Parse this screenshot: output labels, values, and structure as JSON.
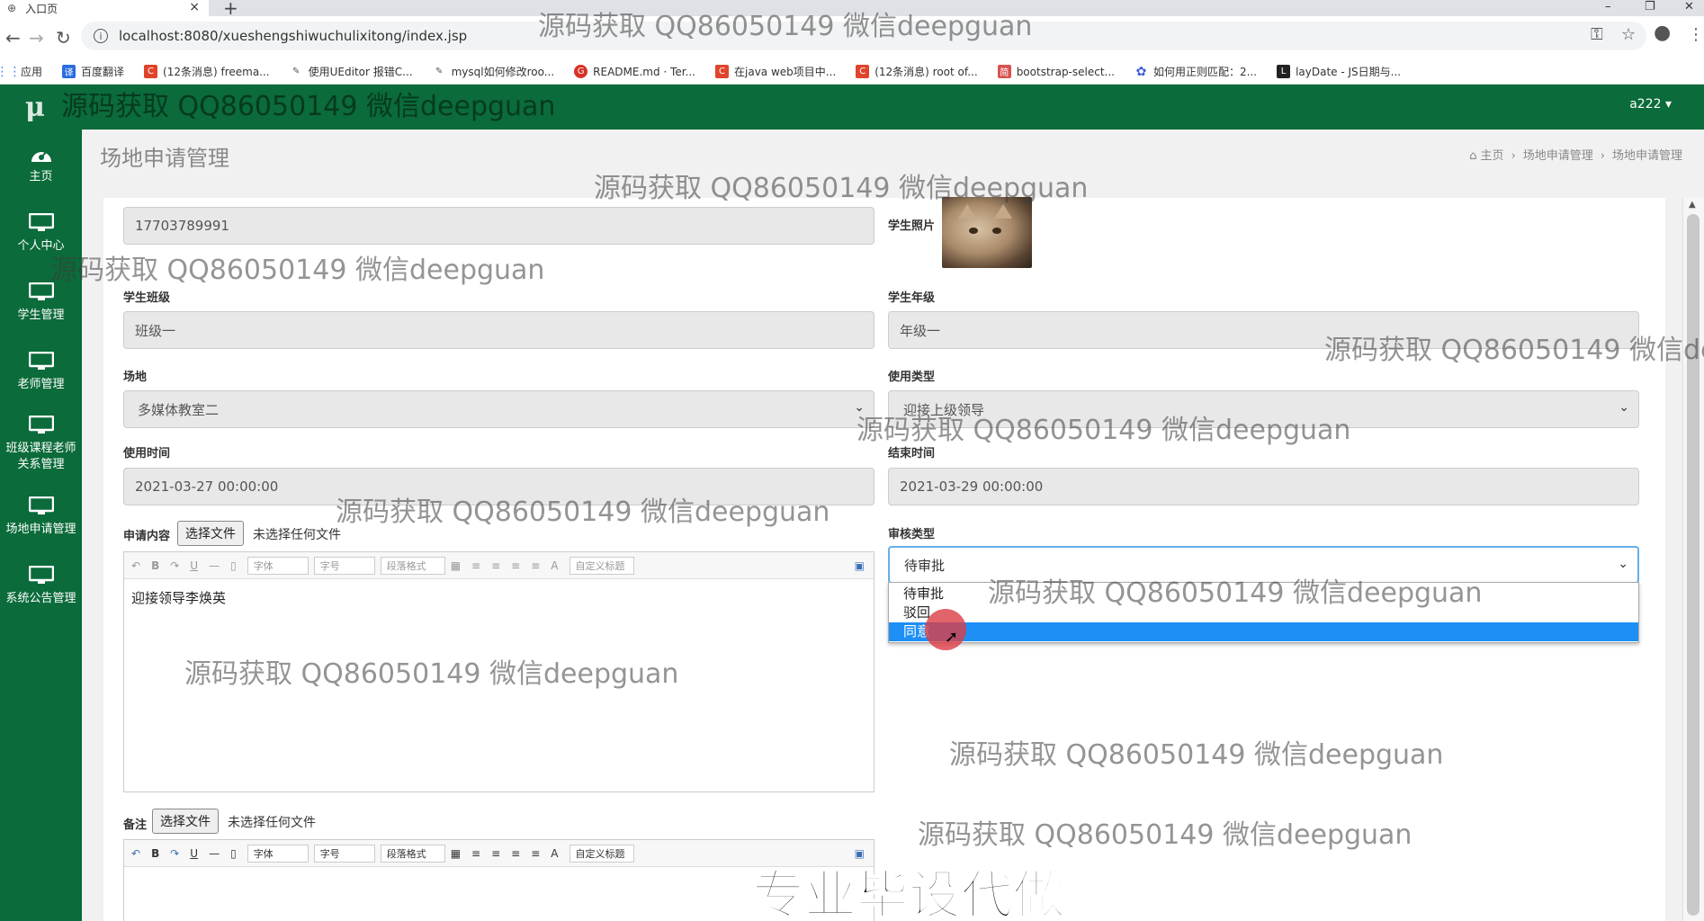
{
  "browser": {
    "tab_title": "入口页",
    "url": "localhost:8080/xueshengshiwuchulixitong/index.jsp",
    "bookmarks": [
      {
        "label": "应用",
        "color": "#4285f4"
      },
      {
        "label": "百度翻译",
        "color": "#2b6de0"
      },
      {
        "label": "(12条消息) freema...",
        "color": "#e0442b"
      },
      {
        "label": "使用UEditor 报错C...",
        "color": "#555555"
      },
      {
        "label": "mysql如何修改roo...",
        "color": "#555555"
      },
      {
        "label": "README.md · Ter...",
        "color": "#d93025"
      },
      {
        "label": "在java web项目中...",
        "color": "#e0442b"
      },
      {
        "label": "(12条消息) root of...",
        "color": "#e0442b"
      },
      {
        "label": "bootstrap-select...",
        "color": "#d9534f"
      },
      {
        "label": "如何用正则匹配：2...",
        "color": "#3b5bdb"
      },
      {
        "label": "layDate - JS日期与...",
        "color": "#222222"
      }
    ]
  },
  "app": {
    "logo": "μ",
    "user": "a222 ▾",
    "sidebar": [
      {
        "label": "主页",
        "icon": "dashboard-icon"
      },
      {
        "label": "个人中心",
        "icon": "monitor-icon"
      },
      {
        "label": "学生管理",
        "icon": "monitor-icon"
      },
      {
        "label": "老师管理",
        "icon": "monitor-icon"
      },
      {
        "label": "班级课程老师关系管理",
        "icon": "monitor-icon"
      },
      {
        "label": "场地申请管理",
        "icon": "monitor-icon"
      },
      {
        "label": "系统公告管理",
        "icon": "monitor-icon"
      }
    ],
    "page_title": "场地申请管理",
    "breadcrumb": [
      "主页",
      "场地申请管理",
      "场地申请管理"
    ]
  },
  "form": {
    "phone": "17703789991",
    "photo_label": "学生照片",
    "class_label": "学生班级",
    "class_value": "班级一",
    "grade_label": "学生年级",
    "grade_value": "年级一",
    "venue_label": "场地",
    "venue_value": "多媒体教室二",
    "usage_label": "使用类型",
    "usage_value": "迎接上级领导",
    "start_label": "使用时间",
    "start_value": "2021-03-27 00:00:00",
    "end_label": "结束时间",
    "end_value": "2021-03-29 00:00:00",
    "content_label": "申请内容",
    "file_button": "选择文件",
    "no_file": "未选择任何文件",
    "content_text": "迎接领导李焕英",
    "review_label": "审核类型",
    "review_value": "待审批",
    "review_options": [
      "待审批",
      "驳回",
      "同意"
    ],
    "remark_label": "备注"
  },
  "editor_toolbar": {
    "font": "字体",
    "size": "字号",
    "para": "段落格式",
    "custom": "自定义标题",
    "bold": "B",
    "underline": "U",
    "fontcolor": "A"
  },
  "watermarks": {
    "text": "源码获取 QQ86050149 微信deepguan",
    "truncated": "源码获取 QQ86050149 微信de",
    "banner": "专业毕设代做"
  }
}
